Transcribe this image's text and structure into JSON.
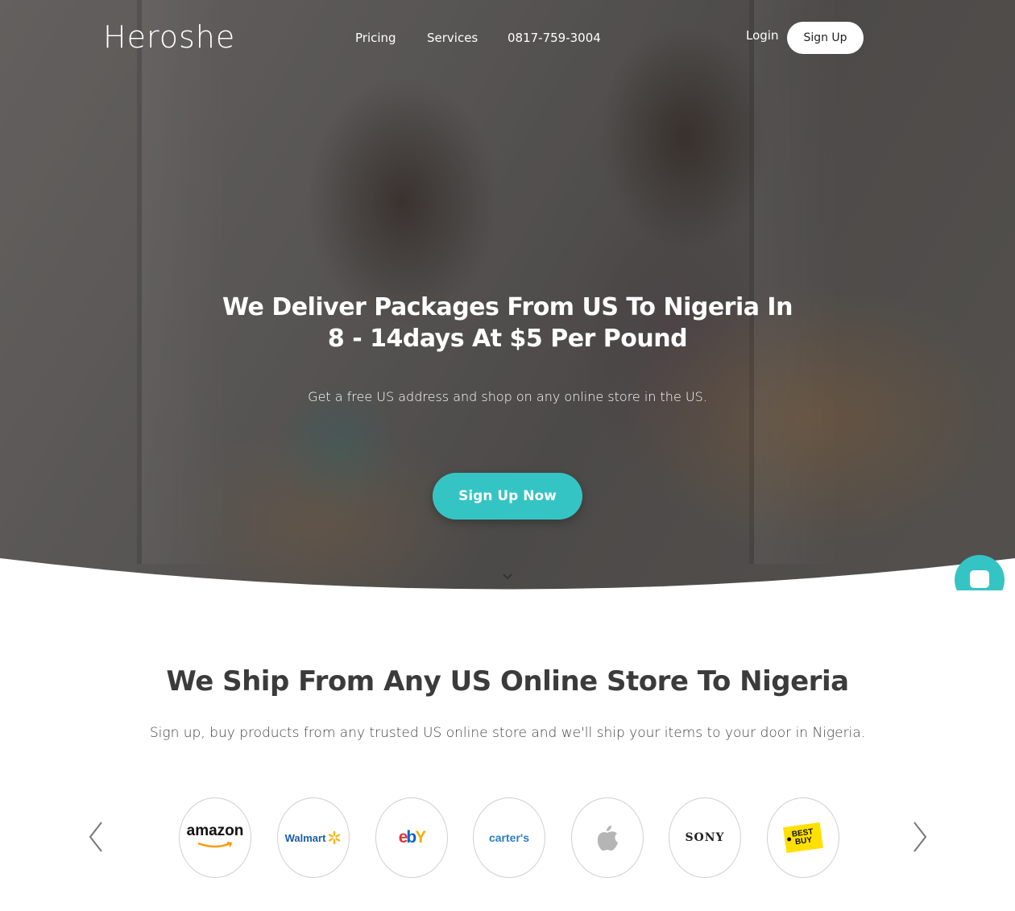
{
  "header": {
    "logo": "Heroshe",
    "nav": [
      {
        "label": "Pricing"
      },
      {
        "label": "Services"
      },
      {
        "label": "0817-759-3004"
      }
    ],
    "login_label": "Login",
    "signup_label": "Sign Up"
  },
  "hero": {
    "title_line1": "We Deliver Packages From US To Nigeria In",
    "title_line2": "8 - 14days At $5 Per Pound",
    "subtitle": "Get a free US address and shop on any online store in the US.",
    "cta_label": "Sign Up Now",
    "scroll_icon": "chevron-down-icon",
    "chat_icon": "chat-icon"
  },
  "stores": {
    "title": "We Ship From Any US Online Store To Nigeria",
    "subtitle": "Sign up, buy products from any trusted US online store and we'll ship your items to your door in Nigeria.",
    "logos": [
      {
        "name": "amazon",
        "text": "amazon",
        "color": "#111111"
      },
      {
        "name": "walmart",
        "text": "Walmart",
        "color": "#1a5ca8"
      },
      {
        "name": "ebay",
        "text": "ebY",
        "color": "#e53238"
      },
      {
        "name": "carters",
        "text": "carter's",
        "color": "#2a7fc1"
      },
      {
        "name": "apple",
        "text": "",
        "color": "#b5b5b5"
      },
      {
        "name": "sony",
        "text": "SONY",
        "color": "#222222"
      },
      {
        "name": "bestbuy",
        "text": "BEST BUY",
        "color": "#ffe000"
      }
    ]
  },
  "colors": {
    "accent": "#35c4c4",
    "text_dark": "#3b3b3b"
  }
}
